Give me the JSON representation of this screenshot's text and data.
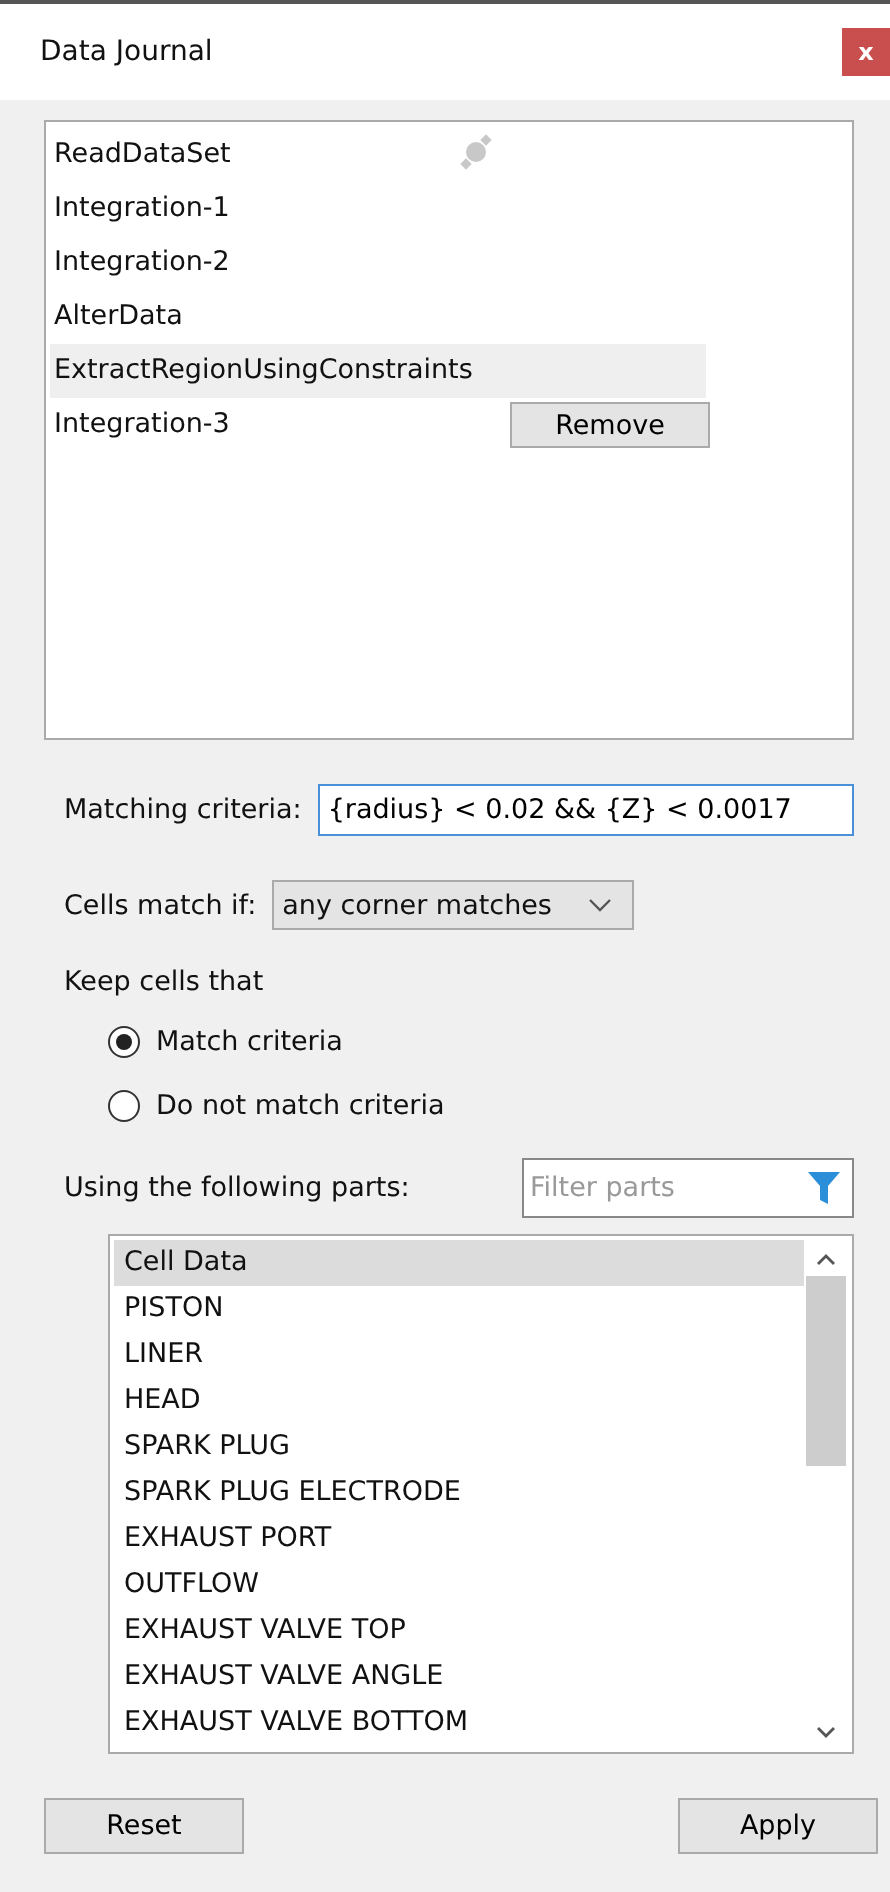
{
  "window": {
    "title": "Data Journal",
    "close": "x"
  },
  "journal": {
    "items": [
      {
        "label": "ReadDataSet",
        "selected": false,
        "icon": true
      },
      {
        "label": "Integration-1",
        "selected": false
      },
      {
        "label": "Integration-2",
        "selected": false
      },
      {
        "label": "AlterData",
        "selected": false
      },
      {
        "label": "ExtractRegionUsingConstraints",
        "selected": true
      },
      {
        "label": "Integration-3",
        "selected": false,
        "button": "Remove"
      }
    ]
  },
  "matching": {
    "label": "Matching criteria:",
    "value": "{radius} < 0.02 && {Z} < 0.0017"
  },
  "cells_match": {
    "label": "Cells match if:",
    "value": "any corner matches"
  },
  "keep": {
    "label": "Keep cells that",
    "options": [
      {
        "label": "Match criteria",
        "selected": true
      },
      {
        "label": "Do not match criteria",
        "selected": false
      }
    ]
  },
  "parts": {
    "label": "Using the following parts:",
    "filter_placeholder": "Filter parts",
    "items": [
      {
        "label": "Cell Data",
        "selected": true
      },
      {
        "label": "PISTON",
        "selected": false
      },
      {
        "label": "LINER",
        "selected": false
      },
      {
        "label": "HEAD",
        "selected": false
      },
      {
        "label": "SPARK PLUG",
        "selected": false
      },
      {
        "label": "SPARK PLUG ELECTRODE",
        "selected": false
      },
      {
        "label": "EXHAUST PORT",
        "selected": false
      },
      {
        "label": "OUTFLOW",
        "selected": false
      },
      {
        "label": "EXHAUST VALVE TOP",
        "selected": false
      },
      {
        "label": "EXHAUST VALVE ANGLE",
        "selected": false
      },
      {
        "label": "EXHAUST VALVE BOTTOM",
        "selected": false
      }
    ]
  },
  "buttons": [
    "Reset",
    "Apply"
  ]
}
